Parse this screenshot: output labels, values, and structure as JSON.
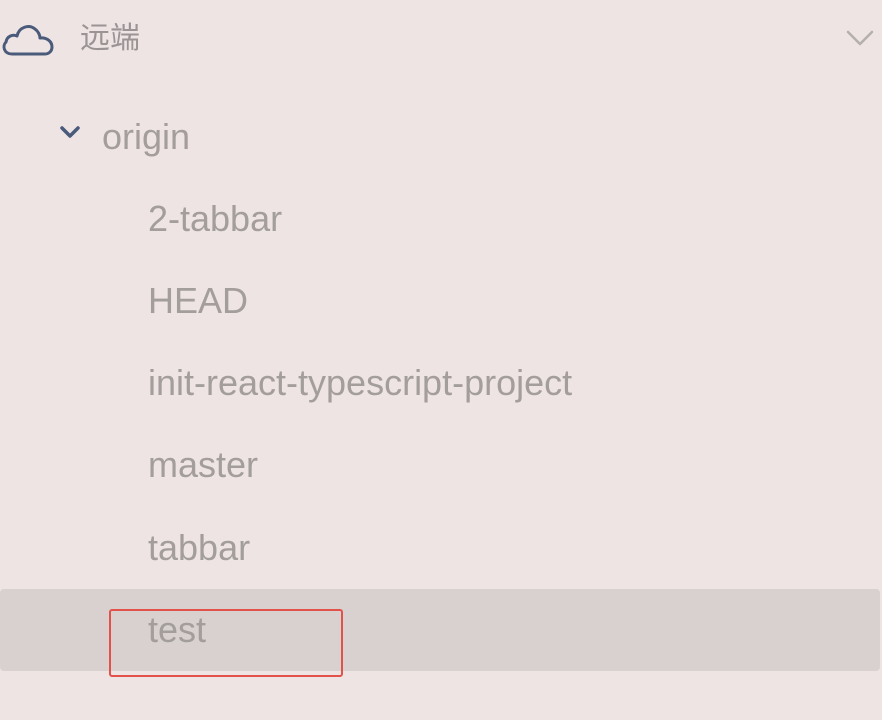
{
  "section": {
    "title": "远端",
    "icon": "cloud-icon",
    "collapse_icon": "chevron-down-icon"
  },
  "remote": {
    "name": "origin",
    "expand_icon": "chevron-down-icon",
    "branches": [
      {
        "label": "2-tabbar"
      },
      {
        "label": "HEAD"
      },
      {
        "label": "init-react-typescript-project"
      },
      {
        "label": "master"
      },
      {
        "label": "tabbar"
      },
      {
        "label": "test"
      }
    ]
  },
  "colors": {
    "background": "#ede4e3",
    "selected_row": "#d8d1d0",
    "text": "#a39d9c",
    "icon_stroke": "#4a5a7a",
    "highlight_box": "#e2514a"
  }
}
